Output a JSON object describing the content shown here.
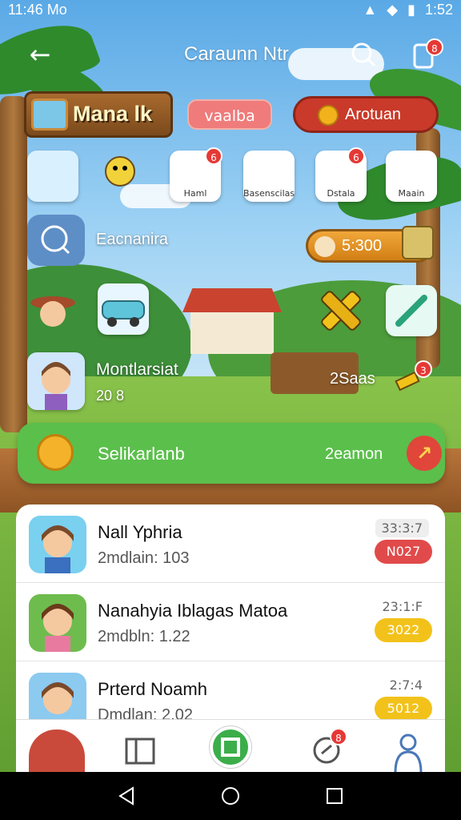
{
  "status_bar": {
    "time": "11:46 Mo",
    "battery": "1:52"
  },
  "app_bar": {
    "title": "Caraunn Ntr"
  },
  "header": {
    "sign_label": "Mana lk",
    "pink_pill_label": "vaalba",
    "red_pill_label": "Arotuan"
  },
  "shortcuts": [
    {
      "label": "",
      "badge": ""
    },
    {
      "label": "",
      "badge": ""
    },
    {
      "label": "Haml",
      "badge": "6"
    },
    {
      "label": "Basenscilas",
      "badge": ""
    },
    {
      "label": "Dstala",
      "badge": "6"
    },
    {
      "label": "Maain",
      "badge": ""
    }
  ],
  "search_row": {
    "label": "Eacnanira",
    "coins": "5:300"
  },
  "profile_row": {
    "name": "Montlarsiat",
    "value": "20 8",
    "right_label": "2Saas",
    "badge": "3"
  },
  "action_bar": {
    "label": "Selikarlanb",
    "sub_label": "2eamon"
  },
  "list": [
    {
      "name": "Nall Yphria",
      "sub": "2mdlain: 103",
      "time": "33:3:7",
      "tag": "N027",
      "tag_color": "#e14a4a"
    },
    {
      "name": "Nanahyia Iblagas Matoa",
      "sub": "2mdbln: 1.22",
      "time": "23:1:F",
      "tag": "3022",
      "tag_color": "#f2c21a"
    },
    {
      "name": "Prterd Noamh",
      "sub": "Dmdlan: 2.02",
      "time": "2:7:4",
      "tag": "5012",
      "tag_color": "#f2c21a"
    }
  ],
  "tabbar": {
    "badge": "8"
  },
  "icons": [
    "back-arrow-icon",
    "search-icon",
    "clipboard-icon",
    "coin-icon",
    "map-icon",
    "gear-icon",
    "home-icon",
    "back-icon",
    "circle-home-icon",
    "recents-icon"
  ]
}
